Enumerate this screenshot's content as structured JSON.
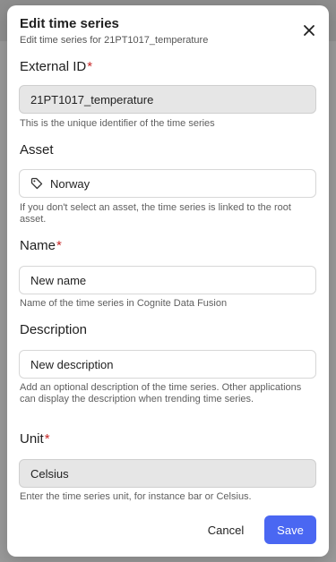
{
  "dialog": {
    "title": "Edit time series",
    "subtitle": "Edit time series for 21PT1017_temperature"
  },
  "fields": {
    "external_id": {
      "label": "External ID",
      "required_mark": "*",
      "value": "21PT1017_temperature",
      "helper": "This is the unique identifier of the time series"
    },
    "asset": {
      "label": "Asset",
      "value": "Norway",
      "helper": "If you don't select an asset, the time series is linked to the root asset."
    },
    "name": {
      "label": "Name",
      "required_mark": "*",
      "value": "New name",
      "helper": "Name of the time series in Cognite Data Fusion"
    },
    "description": {
      "label": "Description",
      "value": "New description",
      "helper": "Add an optional description of the time series. Other applications can display the description when trending time series."
    },
    "unit": {
      "label": "Unit",
      "required_mark": "*",
      "value": "Celsius",
      "helper": "Enter the time series unit, for instance bar or Celsius."
    }
  },
  "footer": {
    "cancel_label": "Cancel",
    "save_label": "Save"
  },
  "colors": {
    "primary": "#4a67f2",
    "required": "#c62828",
    "disabled_bg": "#e6e6e6"
  }
}
